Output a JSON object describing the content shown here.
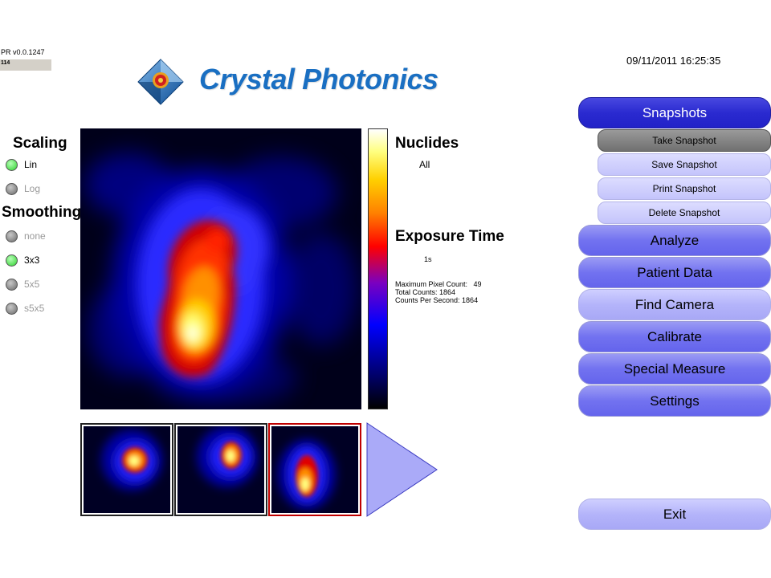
{
  "app": {
    "version": "PR v0.0.1247",
    "build": "114",
    "brand": "Crystal Photonics",
    "timestamp": "09/11/2011 16:25:35"
  },
  "scaling": {
    "title": "Scaling",
    "options": [
      {
        "label": "Lin",
        "selected": true
      },
      {
        "label": "Log",
        "selected": false
      }
    ]
  },
  "smoothing": {
    "title": "Smoothing",
    "options": [
      {
        "label": "none",
        "selected": false
      },
      {
        "label": "3x3",
        "selected": true
      },
      {
        "label": "5x5",
        "selected": false
      },
      {
        "label": "s5x5",
        "selected": false
      }
    ]
  },
  "info": {
    "nuclides_title": "Nuclides",
    "nuclides_value": "All",
    "exposure_title": "Exposure Time",
    "exposure_value": "1s",
    "stats": {
      "max_pixel_label": "Maximum Pixel Count:",
      "max_pixel_value": "49",
      "total_counts": "Total Counts: 1864",
      "cps": "Counts Per Second: 1864"
    }
  },
  "menu": {
    "snapshots": "Snapshots",
    "sub": [
      "Take Snapshot",
      "Save Snapshot",
      "Print Snapshot",
      "Delete Snapshot"
    ],
    "items": [
      "Analyze",
      "Patient Data",
      "Find Camera",
      "Calibrate",
      "Special Measure",
      "Settings"
    ],
    "exit": "Exit"
  },
  "colors": {
    "accent_primary": "#2a2ad0",
    "accent_secondary": "#7272f0",
    "selected_thumb_border": "#c00000",
    "indicator_on": "#2ed12e",
    "indicator_off": "#6a6a6a",
    "brand_blue": "#1a6fc2"
  },
  "icons": {
    "logo": "crystal-diamond-target-icon",
    "next": "triangle-right-icon"
  }
}
